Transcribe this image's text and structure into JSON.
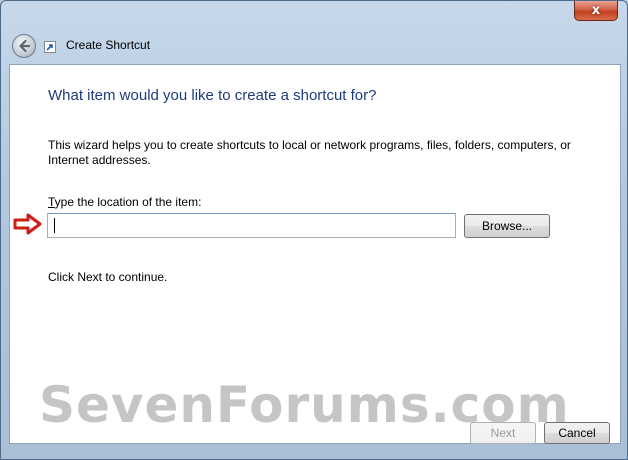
{
  "window": {
    "title": "Create Shortcut",
    "close_label": "x"
  },
  "wizard": {
    "heading": "What item would you like to create a shortcut for?",
    "description": "This wizard helps you to create shortcuts to local or network programs, files, folders, computers, or Internet addresses.",
    "location_label_accel": "T",
    "location_label_rest": "ype the location of the item:",
    "location_value": "",
    "browse_label": "Browse...",
    "continue_text": "Click Next to continue."
  },
  "buttons": {
    "next_label": "Next",
    "cancel_label": "Cancel"
  },
  "watermark": "SevenForums.com",
  "colors": {
    "heading": "#1e3c7b",
    "arrow": "#d11a1a"
  }
}
